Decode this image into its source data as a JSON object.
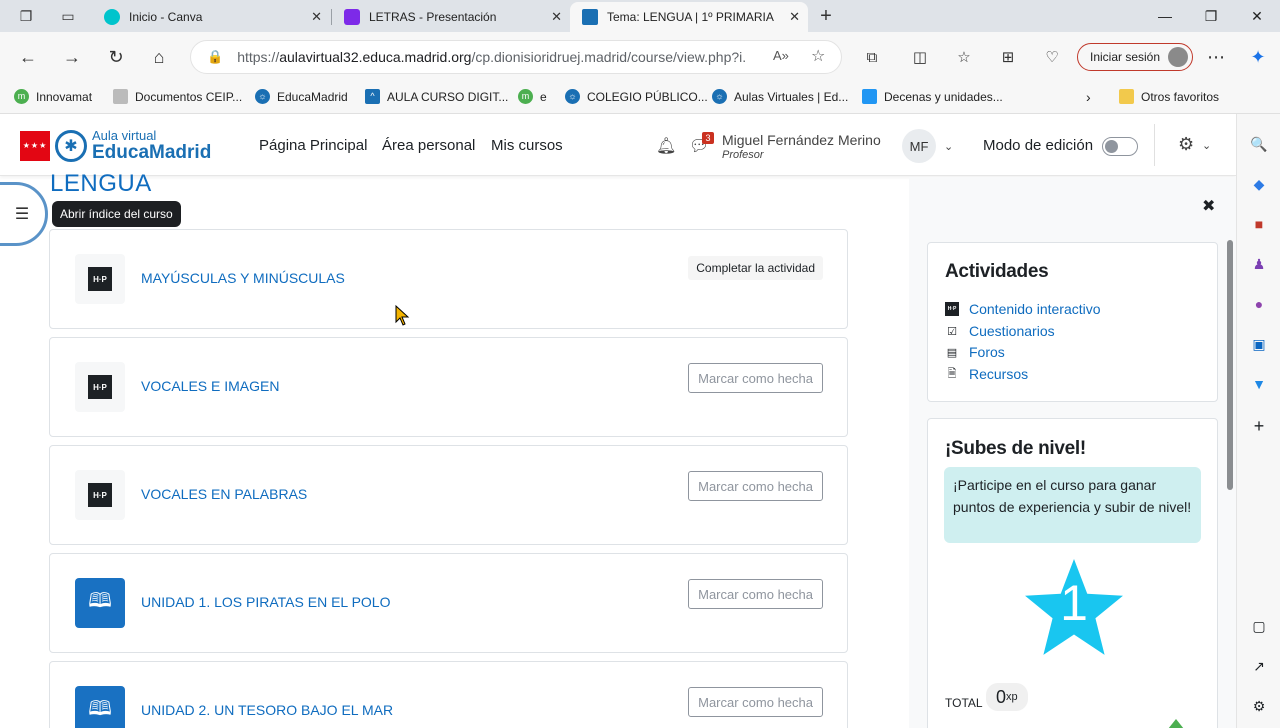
{
  "browser": {
    "tabs": [
      {
        "title": "Inicio - Canva",
        "color": "#00c4cc"
      },
      {
        "title": "LETRAS - Presentación",
        "color": "#7d2ae8"
      },
      {
        "title": "Tema: LENGUA | 1º PRIMARIA",
        "color": "#1a6fb3"
      }
    ],
    "url_prefix": "https://",
    "url_domain": "aulavirtual32.educa.madrid.org",
    "url_rest": "/cp.dionisioridruej.madrid/course/view.php?i...",
    "signin_label": "Iniciar sesión",
    "bookmarks": [
      "Innovamat",
      "Documentos CEIP...",
      "EducaMadrid",
      "AULA CURSO DIGIT...",
      "e",
      "COLEGIO PÚBLICO...",
      "Aulas Virtuales | Ed...",
      "Decenas y unidades..."
    ],
    "other_favorites": "Otros favoritos"
  },
  "site": {
    "logo_line1": "Aula virtual",
    "logo_line2": "EducaMadrid",
    "nav": [
      "Página Principal",
      "Área personal",
      "Mis cursos"
    ],
    "messages_count": "3",
    "user_name": "Miguel Fernández Merino",
    "user_role": "Profesor",
    "user_initials": "MF",
    "edit_mode_label": "Modo de edición"
  },
  "course": {
    "title": "LENGUA",
    "index_tooltip": "Abrir índice del curso",
    "activities": [
      {
        "title": "MAYÚSCULAS Y MINÚSCULAS",
        "type": "h5p",
        "action": "Completar la actividad"
      },
      {
        "title": "VOCALES E IMAGEN",
        "type": "h5p",
        "action": "Marcar como hecha"
      },
      {
        "title": "VOCALES EN PALABRAS",
        "type": "h5p",
        "action": "Marcar como hecha"
      },
      {
        "title": "UNIDAD 1. LOS PIRATAS EN EL POLO",
        "type": "book",
        "action": "Marcar como hecha"
      },
      {
        "title": "UNIDAD 2. UN TESORO BAJO EL MAR",
        "type": "book",
        "action": "Marcar como hecha"
      }
    ]
  },
  "drawer": {
    "activities_title": "Actividades",
    "activity_links": [
      "Contenido interactivo",
      "Cuestionarios",
      "Foros",
      "Recursos"
    ],
    "level_title": "¡Subes de nivel!",
    "level_info": "¡Participe en el curso para ganar puntos de experiencia y subir de nivel!",
    "level_number": "1",
    "total_label": "TOTAL",
    "xp_value": "0",
    "xp_unit": "xp"
  },
  "colors": {
    "link": "#0f6cbf",
    "star": "#19c6f0",
    "info_bg": "#cfeff0"
  }
}
